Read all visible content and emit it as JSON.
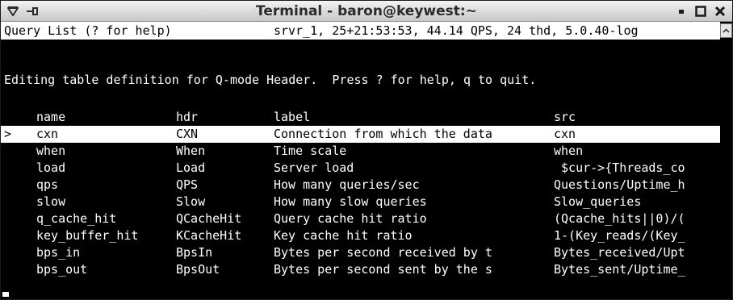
{
  "window": {
    "title": "Terminal - baron@keywest:~"
  },
  "status": {
    "left": "Query List (? for help)",
    "right": "srvr_1, 25+21:53:53, 44.14 QPS, 24 thd, 5.0.40-log"
  },
  "message": "Editing table definition for Q-mode Header.  Press ? for help, q to quit.",
  "table": {
    "headers": {
      "name": "name",
      "hdr": "hdr",
      "label": "label",
      "src": "src"
    },
    "rows": [
      {
        "marker": ">",
        "name": "cxn",
        "hdr": "CXN",
        "label": "Connection from which the data",
        "src": "cxn"
      },
      {
        "marker": "",
        "name": "when",
        "hdr": "When",
        "label": "Time scale",
        "src": "when"
      },
      {
        "marker": "",
        "name": "load",
        "hdr": "Load",
        "label": "Server load",
        "src": " $cur->{Threads_co"
      },
      {
        "marker": "",
        "name": "qps",
        "hdr": "QPS",
        "label": "How many queries/sec",
        "src": "Questions/Uptime_h"
      },
      {
        "marker": "",
        "name": "slow",
        "hdr": "Slow",
        "label": "How many slow queries",
        "src": "Slow_queries"
      },
      {
        "marker": "",
        "name": "q_cache_hit",
        "hdr": "QCacheHit",
        "label": "Query cache hit ratio",
        "src": "(Qcache_hits||0)/("
      },
      {
        "marker": "",
        "name": "key_buffer_hit",
        "hdr": "KCacheHit",
        "label": "Key cache hit ratio",
        "src": "1-(Key_reads/(Key_"
      },
      {
        "marker": "",
        "name": "bps_in",
        "hdr": "BpsIn",
        "label": "Bytes per second received by t",
        "src": "Bytes_received/Upt"
      },
      {
        "marker": "",
        "name": "bps_out",
        "hdr": "BpsOut",
        "label": "Bytes per second sent by the s",
        "src": "Bytes_sent/Uptime_"
      }
    ]
  },
  "colors": {
    "terminal_bg": "#000000",
    "terminal_fg": "#ffffff",
    "highlight_bg": "#ffffff",
    "highlight_fg": "#000000"
  },
  "icons": {
    "menu": "down-triangle-icon",
    "stick": "stick-pin-icon",
    "minimize": "minimize-icon",
    "maximize": "maximize-icon",
    "close": "close-icon",
    "scroll_up": "scroll-up-arrow-icon"
  }
}
